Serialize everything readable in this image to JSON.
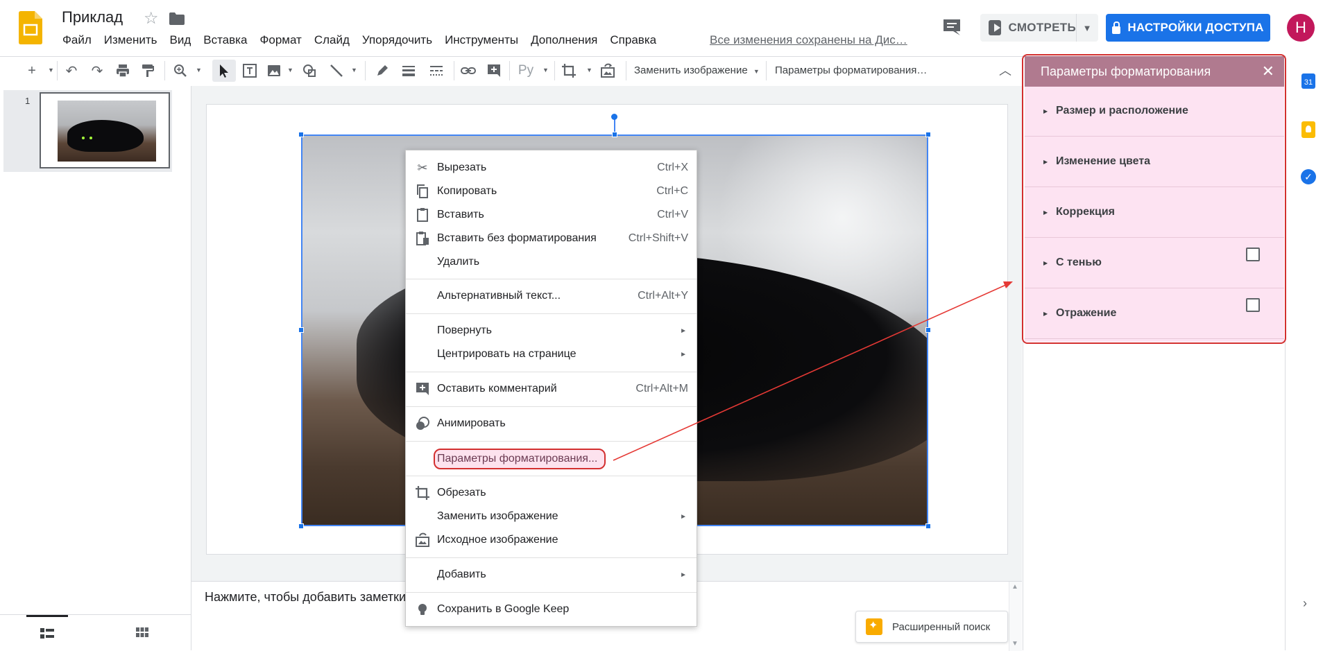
{
  "header": {
    "doc_title": "Приклад",
    "menu": [
      "Файл",
      "Изменить",
      "Вид",
      "Вставка",
      "Формат",
      "Слайд",
      "Упорядочить",
      "Инструменты",
      "Дополнения",
      "Справка"
    ],
    "save_status": "Все изменения сохранены на Дис…",
    "present_label": "СМОТРЕТЬ",
    "share_label": "НАСТРОЙКИ ДОСТУПА",
    "avatar_letter": "Н"
  },
  "toolbar": {
    "font_label": "Ру",
    "replace_image_label": "Заменить изображение",
    "format_options_label": "Параметры форматирования…"
  },
  "filmstrip": {
    "slide_number": "1"
  },
  "notes": {
    "placeholder": "Нажмите, чтобы добавить заметки",
    "explore_label": "Расширенный поиск"
  },
  "context_menu": {
    "items": [
      {
        "label": "Вырезать",
        "shortcut": "Ctrl+X",
        "icon": "scissors-icon"
      },
      {
        "label": "Копировать",
        "shortcut": "Ctrl+C",
        "icon": "copy-icon"
      },
      {
        "label": "Вставить",
        "shortcut": "Ctrl+V",
        "icon": "clipboard-icon"
      },
      {
        "label": "Вставить без форматирования",
        "shortcut": "Ctrl+Shift+V",
        "icon": "clipboard-plain-icon"
      },
      {
        "label": "Удалить",
        "shortcut": ""
      },
      {
        "label": "Альтернативный текст...",
        "shortcut": "Ctrl+Alt+Y"
      },
      {
        "label": "Повернуть",
        "submenu": true
      },
      {
        "label": "Центрировать на странице",
        "submenu": true
      },
      {
        "label": "Оставить комментарий",
        "shortcut": "Ctrl+Alt+M",
        "icon": "add-comment-icon"
      },
      {
        "label": "Анимировать",
        "icon": "animate-icon"
      },
      {
        "label": "Параметры форматирования...",
        "highlighted": true
      },
      {
        "label": "Обрезать",
        "icon": "crop-icon"
      },
      {
        "label": "Заменить изображение",
        "submenu": true
      },
      {
        "label": "Исходное изображение",
        "icon": "reset-image-icon"
      },
      {
        "label": "Добавить",
        "submenu": true
      },
      {
        "label": "Сохранить в Google Keep",
        "icon": "keep-bulb-icon"
      }
    ]
  },
  "format_panel": {
    "title": "Параметры форматирования",
    "sections": [
      {
        "label": "Размер и расположение",
        "checkbox": false
      },
      {
        "label": "Изменение цвета",
        "checkbox": false
      },
      {
        "label": "Коррекция",
        "checkbox": false
      },
      {
        "label": "С тенью",
        "checkbox": true,
        "checked": false
      },
      {
        "label": "Отражение",
        "checkbox": true,
        "checked": false
      }
    ]
  },
  "side_rail": {
    "calendar_day": "31"
  },
  "colors": {
    "accent": "#1a73e8",
    "annotation_red": "#d32f2f",
    "panel_header": "#b07a8f",
    "panel_bg": "#fde3f2",
    "logo": "#f4b400"
  }
}
